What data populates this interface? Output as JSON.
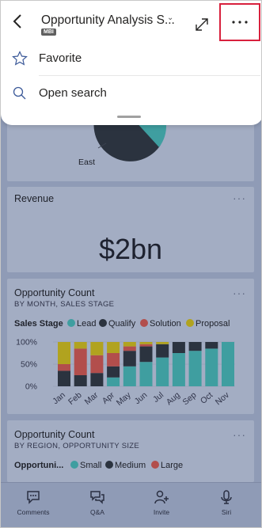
{
  "header": {
    "title": "Opportunity Analysis S...",
    "badge": "MBI"
  },
  "menu": {
    "items": [
      {
        "label": "Favorite",
        "icon": "star-icon"
      },
      {
        "label": "Open search",
        "icon": "search-icon"
      }
    ]
  },
  "pie_tile": {
    "label": "East"
  },
  "revenue_tile": {
    "title": "Revenue",
    "value": "$2bn"
  },
  "opp_month_tile": {
    "title": "Opportunity Count",
    "subtitle": "BY MONTH, SALES STAGE",
    "legend_title": "Sales Stage",
    "legend": [
      {
        "name": "Lead",
        "color": "#3f9ea0"
      },
      {
        "name": "Qualify",
        "color": "#2b333f"
      },
      {
        "name": "Solution",
        "color": "#b24e4c"
      },
      {
        "name": "Proposal",
        "color": "#b1a31f"
      }
    ]
  },
  "opp_region_tile": {
    "title": "Opportunity Count",
    "subtitle": "BY REGION, OPPORTUNITY SIZE",
    "legend_title": "Opportuni...",
    "legend": [
      {
        "name": "Small",
        "color": "#3f9ea0"
      },
      {
        "name": "Medium",
        "color": "#2b333f"
      },
      {
        "name": "Large",
        "color": "#b24e4c"
      }
    ]
  },
  "tabs": [
    {
      "label": "Comments",
      "icon": "comments-icon"
    },
    {
      "label": "Q&A",
      "icon": "qna-icon"
    },
    {
      "label": "Invite",
      "icon": "invite-icon"
    },
    {
      "label": "Siri",
      "icon": "microphone-icon"
    }
  ],
  "chart_data": {
    "type": "bar",
    "stacked": "100%",
    "categories": [
      "Jan",
      "Feb",
      "Mar",
      "Apr",
      "May",
      "Jun",
      "Jul",
      "Aug",
      "Sep",
      "Oct",
      "Nov"
    ],
    "series": [
      {
        "name": "Lead",
        "values": [
          0,
          0,
          0,
          20,
          45,
          55,
          65,
          75,
          80,
          85,
          100
        ]
      },
      {
        "name": "Qualify",
        "values": [
          35,
          25,
          30,
          25,
          35,
          35,
          30,
          25,
          20,
          15,
          0
        ]
      },
      {
        "name": "Solution",
        "values": [
          15,
          60,
          40,
          30,
          10,
          5,
          0,
          0,
          0,
          0,
          0
        ]
      },
      {
        "name": "Proposal",
        "values": [
          50,
          15,
          30,
          25,
          10,
          5,
          5,
          0,
          0,
          0,
          0
        ]
      }
    ],
    "ylabels": [
      "100%",
      "50%",
      "0%"
    ],
    "ylim": [
      0,
      100
    ]
  }
}
